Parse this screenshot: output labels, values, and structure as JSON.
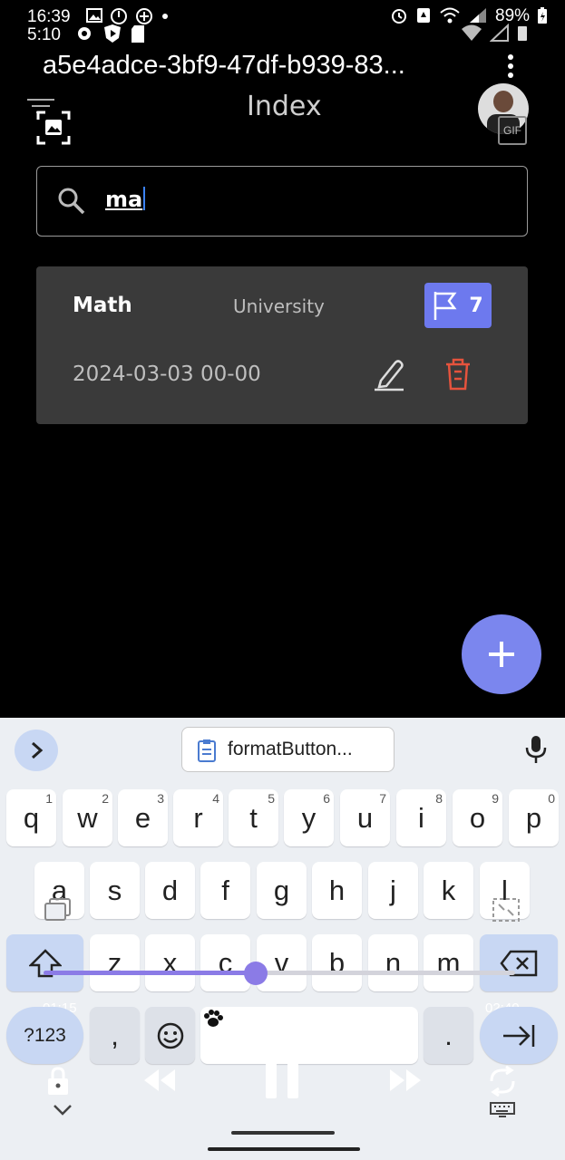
{
  "status_bar": {
    "time1": "16:39",
    "time2": "5:10",
    "battery": "89%"
  },
  "app_bar": {
    "title": "a5e4adce-3bf9-47df-b939-83...",
    "menu_icon": "more-vert-icon"
  },
  "header": {
    "title": "Index",
    "filter_icon": "filter-icon",
    "screenshot_icon": "image-scan-icon",
    "gif_label": "GIF"
  },
  "search": {
    "value": "ma",
    "icon": "search-icon"
  },
  "cards": [
    {
      "subject": "Math",
      "type": "University",
      "count": "7",
      "date": "2024-03-03 00-00"
    }
  ],
  "fab": {
    "icon": "plus-icon"
  },
  "keyboard": {
    "suggestion": "formatButton...",
    "row1": [
      {
        "k": "q",
        "h": "1"
      },
      {
        "k": "w",
        "h": "2"
      },
      {
        "k": "e",
        "h": "3"
      },
      {
        "k": "r",
        "h": "4"
      },
      {
        "k": "t",
        "h": "5"
      },
      {
        "k": "y",
        "h": "6"
      },
      {
        "k": "u",
        "h": "7"
      },
      {
        "k": "i",
        "h": "8"
      },
      {
        "k": "o",
        "h": "9"
      },
      {
        "k": "p",
        "h": "0"
      }
    ],
    "row2": [
      "a",
      "s",
      "d",
      "f",
      "g",
      "h",
      "j",
      "k",
      "l"
    ],
    "row3": [
      "z",
      "x",
      "c",
      "v",
      "b",
      "n",
      "m"
    ],
    "sym_label": "?123",
    "comma": ",",
    "period": ".",
    "media_start": "01:15",
    "media_end": "02:40",
    "media_progress": 0.45
  },
  "colors": {
    "accent": "#6d79ee",
    "fab": "#7b86ee",
    "delete": "#e5533d"
  }
}
